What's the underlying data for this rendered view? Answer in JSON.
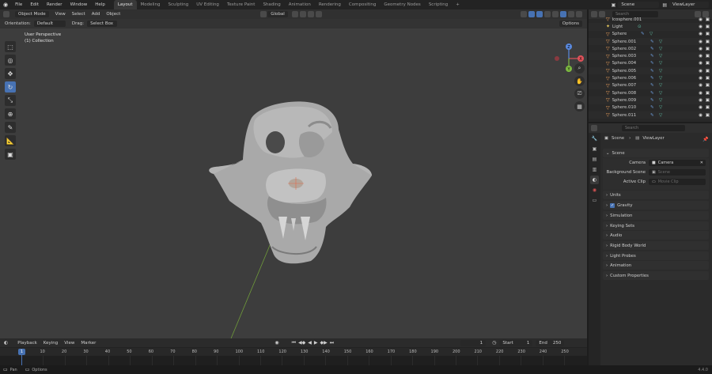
{
  "topbar": {
    "menus": [
      "File",
      "Edit",
      "Render",
      "Window",
      "Help"
    ],
    "workspaces": [
      "Layout",
      "Modeling",
      "Sculpting",
      "UV Editing",
      "Texture Paint",
      "Shading",
      "Animation",
      "Rendering",
      "Compositing",
      "Geometry Nodes",
      "Scripting"
    ],
    "active_workspace": "Layout",
    "add_tab": "+",
    "scene": "Scene",
    "view_layer": "ViewLayer"
  },
  "viewport": {
    "mode": "Object Mode",
    "menus": [
      "View",
      "Select",
      "Add",
      "Object"
    ],
    "transform_orientation": "Global",
    "orientation_label": "Orientation:",
    "orientation_value": "Default",
    "drag_label": "Drag:",
    "drag_value": "Select Box",
    "options": "Options",
    "overlay_title": "User Perspective",
    "overlay_collection": "(1) Collection",
    "gizmo": {
      "x": "X",
      "y": "Y",
      "z": "Z"
    }
  },
  "outliner": {
    "search_placeholder": "Search",
    "items": [
      {
        "name": "Icosphere.001",
        "type": "mesh"
      },
      {
        "name": "Light",
        "type": "light"
      },
      {
        "name": "Sphere",
        "type": "mesh"
      },
      {
        "name": "Sphere.001",
        "type": "mesh"
      },
      {
        "name": "Sphere.002",
        "type": "mesh"
      },
      {
        "name": "Sphere.003",
        "type": "mesh"
      },
      {
        "name": "Sphere.004",
        "type": "mesh"
      },
      {
        "name": "Sphere.005",
        "type": "mesh"
      },
      {
        "name": "Sphere.006",
        "type": "mesh"
      },
      {
        "name": "Sphere.007",
        "type": "mesh"
      },
      {
        "name": "Sphere.008",
        "type": "mesh"
      },
      {
        "name": "Sphere.009",
        "type": "mesh"
      },
      {
        "name": "Sphere.010",
        "type": "mesh"
      },
      {
        "name": "Sphere.011",
        "type": "mesh"
      }
    ]
  },
  "properties": {
    "search_placeholder": "Search",
    "breadcrumb_scene": "Scene",
    "breadcrumb_layer": "ViewLayer",
    "scene_panel": "Scene",
    "camera_label": "Camera",
    "camera_value": "Camera",
    "background_scene_label": "Background Scene",
    "background_scene_placeholder": "Scene",
    "active_clip_label": "Active Clip",
    "active_clip_placeholder": "Movie Clip",
    "panels": [
      "Units",
      "Gravity",
      "Simulation",
      "Keying Sets",
      "Audio",
      "Rigid Body World",
      "Light Probes",
      "Animation",
      "Custom Properties"
    ]
  },
  "timeline": {
    "menus": [
      "Playback",
      "Keying",
      "View",
      "Marker"
    ],
    "current_frame": "1",
    "start_label": "Start",
    "start_value": "1",
    "end_label": "End",
    "end_value": "250",
    "ticks": [
      "1",
      "10",
      "20",
      "30",
      "40",
      "50",
      "60",
      "70",
      "80",
      "90",
      "100",
      "110",
      "120",
      "130",
      "140",
      "150",
      "160",
      "170",
      "180",
      "190",
      "200",
      "210",
      "220",
      "230",
      "240",
      "250"
    ]
  },
  "status": {
    "pan": "Pan",
    "options": "Options",
    "version": "4.4.0"
  }
}
